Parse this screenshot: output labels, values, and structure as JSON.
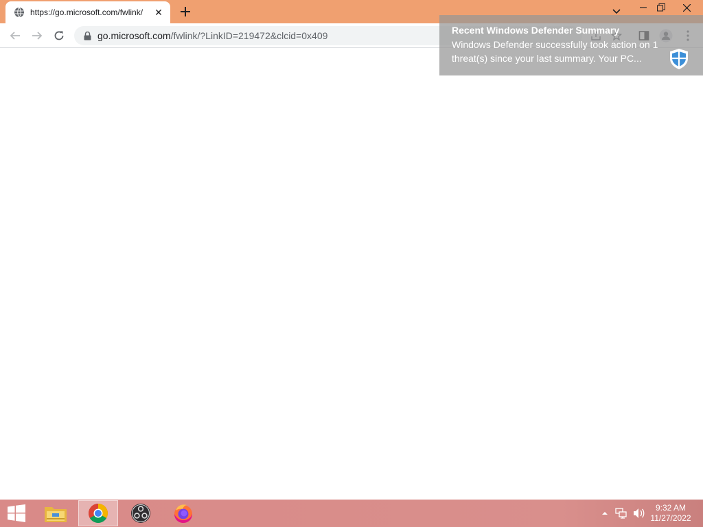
{
  "browser": {
    "tab": {
      "title": "https://go.microsoft.com/fwlink/",
      "favicon": "globe-icon",
      "close": "close-icon"
    },
    "new_tab": "plus-icon",
    "window_controls": [
      "chevron-down-icon",
      "minimize-icon",
      "restore-icon",
      "close-icon"
    ],
    "toolbar": {
      "back": "arrow-left-icon",
      "forward": "arrow-right-icon",
      "reload": "reload-icon",
      "url_host": "go.microsoft.com",
      "url_path": "/fwlink/?LinkID=219472&clcid=0x409",
      "right_icons": [
        "share-icon",
        "star-icon",
        "side-panel-icon",
        "profile-icon",
        "menu-dots-icon"
      ]
    },
    "theme_color": "#f0a070"
  },
  "notification": {
    "title": "Recent Windows Defender Summary",
    "body": "Windows Defender successfully took action on 1 threat(s) since your last summary. Your PC...",
    "icon": "shield-icon"
  },
  "taskbar": {
    "start": "windows-logo-icon",
    "apps": [
      {
        "name": "file-explorer-icon",
        "active": false
      },
      {
        "name": "chrome-icon",
        "active": true
      },
      {
        "name": "obs-icon",
        "active": false
      },
      {
        "name": "firefox-icon",
        "active": false
      }
    ],
    "tray": [
      "chevron-up-icon",
      "network-icon",
      "volume-icon"
    ],
    "time": "9:32 AM",
    "date": "11/27/2022"
  }
}
